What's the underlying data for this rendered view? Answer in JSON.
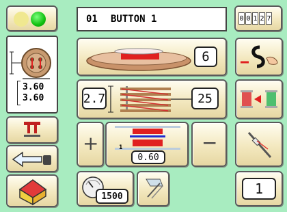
{
  "header": {
    "program_number": "01",
    "program_name": "BUTTON 1",
    "counter_digits": [
      "0",
      "0",
      "1",
      "2",
      "7"
    ]
  },
  "button_size": {
    "width": "3.60",
    "height": "3.60"
  },
  "thread_tension": {
    "value": "6"
  },
  "stitch": {
    "left_value": "2.7",
    "right_value": "25"
  },
  "pitch": {
    "value": "0.60",
    "marker": "1"
  },
  "speed": {
    "value": "1500"
  },
  "count": {
    "value": "1"
  },
  "controls": {
    "plus": "+",
    "minus": "−"
  },
  "colors": {
    "background": "#a8ecc0",
    "button_face": "#f3e8bf",
    "status_yellow": "#f0e890",
    "status_green": "#22cc22",
    "accent_red": "#e02020"
  }
}
